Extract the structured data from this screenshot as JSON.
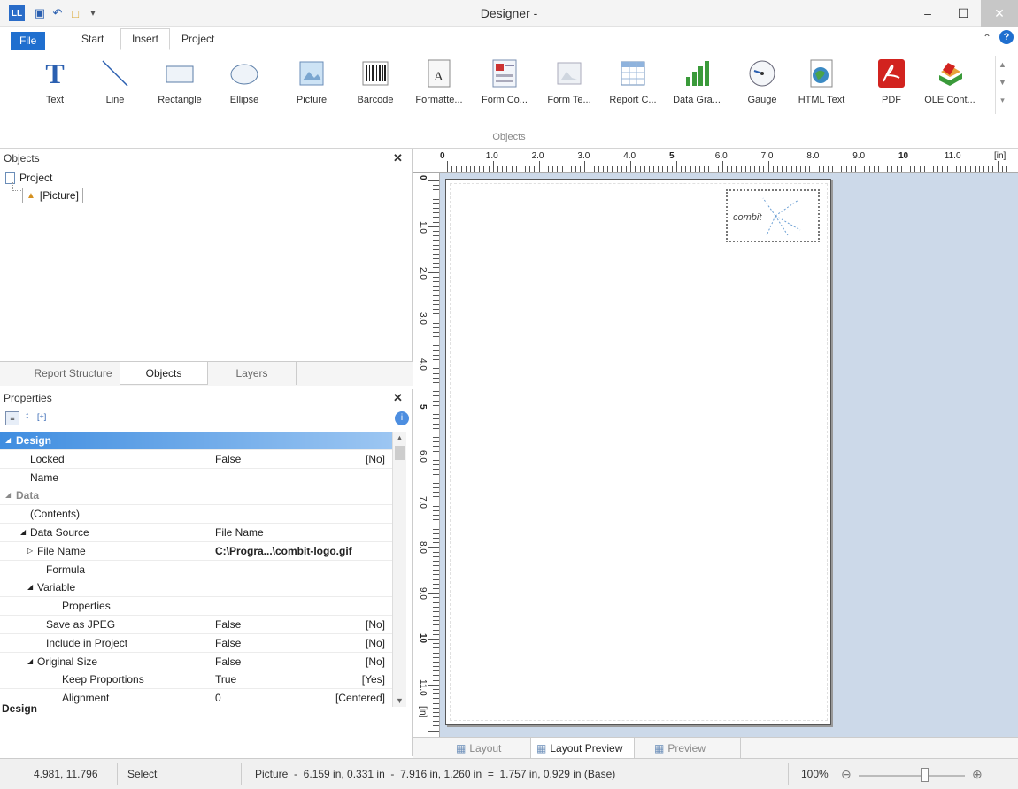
{
  "window": {
    "title": "Designer -"
  },
  "ribbon_tabs": [
    "File",
    "Start",
    "Insert",
    "Project"
  ],
  "ribbon_buttons": [
    {
      "label": "Text",
      "icon": "text-icon"
    },
    {
      "label": "Line",
      "icon": "line-icon"
    },
    {
      "label": "Rectangle",
      "icon": "rectangle-icon"
    },
    {
      "label": "Ellipse",
      "icon": "ellipse-icon"
    },
    {
      "label": "Picture",
      "icon": "picture-icon"
    },
    {
      "label": "Barcode",
      "icon": "barcode-icon"
    },
    {
      "label": "Formatte...",
      "icon": "formatted-text-icon"
    },
    {
      "label": "Form Co...",
      "icon": "form-control-icon"
    },
    {
      "label": "Form Te...",
      "icon": "form-template-icon"
    },
    {
      "label": "Report C...",
      "icon": "report-container-icon"
    },
    {
      "label": "Data Gra...",
      "icon": "data-graphic-icon"
    },
    {
      "label": "Gauge",
      "icon": "gauge-icon"
    },
    {
      "label": "HTML Text",
      "icon": "html-text-icon"
    },
    {
      "label": "PDF",
      "icon": "pdf-icon"
    },
    {
      "label": "OLE Cont...",
      "icon": "ole-container-icon"
    }
  ],
  "ribbon_group": "Objects",
  "objects_panel": {
    "title": "Objects",
    "tree": [
      "Project",
      "[Picture]"
    ]
  },
  "panel_tabs": [
    "Report Structure",
    "Objects",
    "Layers"
  ],
  "properties": {
    "title": "Properties",
    "rows": [
      {
        "k": "Design",
        "v": "",
        "r": "",
        "level": 0,
        "section": true,
        "selected": true
      },
      {
        "k": "Locked",
        "v": "False",
        "r": "[No]",
        "level": 1
      },
      {
        "k": "Name",
        "v": "",
        "r": "",
        "level": 1
      },
      {
        "k": "Data",
        "v": "",
        "r": "",
        "level": 0,
        "section": true
      },
      {
        "k": "(Contents)",
        "v": "",
        "r": "",
        "level": 1
      },
      {
        "k": "Data Source",
        "v": "File Name",
        "r": "",
        "level": 1,
        "expander": "down"
      },
      {
        "k": "File Name",
        "v": "C:\\Progra...\\combit-logo.gif",
        "r": "",
        "level": 2,
        "expander": "right",
        "bold": true
      },
      {
        "k": "Formula",
        "v": "",
        "r": "",
        "level": 2
      },
      {
        "k": "Variable",
        "v": "",
        "r": "",
        "level": 2,
        "expander": "down"
      },
      {
        "k": "Properties",
        "v": "",
        "r": "",
        "level": 3
      },
      {
        "k": "Save as JPEG",
        "v": "False",
        "r": "[No]",
        "level": 2
      },
      {
        "k": "Include in Project",
        "v": "False",
        "r": "[No]",
        "level": 2
      },
      {
        "k": "Original Size",
        "v": "False",
        "r": "[No]",
        "level": 2,
        "expander": "down"
      },
      {
        "k": "Keep Proportions",
        "v": "True",
        "r": "[Yes]",
        "level": 3
      },
      {
        "k": "Alignment",
        "v": "0",
        "r": "[Centered]",
        "level": 3
      }
    ],
    "footer": "Design"
  },
  "ruler_h": [
    "0",
    "1.0",
    "2.0",
    "3.0",
    "4.0",
    "5",
    "6.0",
    "7.0",
    "8.0",
    "9.0",
    "10",
    "11.0",
    "[in]"
  ],
  "ruler_v": [
    "0",
    "1.0",
    "2.0",
    "3.0",
    "4.0",
    "5",
    "6.0",
    "7.0",
    "8.0",
    "9.0",
    "10",
    "11.0",
    "[in]"
  ],
  "canvas_logo": "combit",
  "bottom_tabs": [
    "Layout",
    "Layout Preview",
    "Preview"
  ],
  "status": {
    "coords": "4.981, 11.796",
    "mode": "Select",
    "info": "Picture  -  6.159 in, 0.331 in  -  7.916 in, 1.260 in  =  1.757 in, 0.929 in (Base)",
    "zoom": "100%"
  },
  "colors": {
    "accent": "#1f6fcf",
    "canvas_bg": "#ccd9e9",
    "pdf_red": "#d2231f"
  }
}
